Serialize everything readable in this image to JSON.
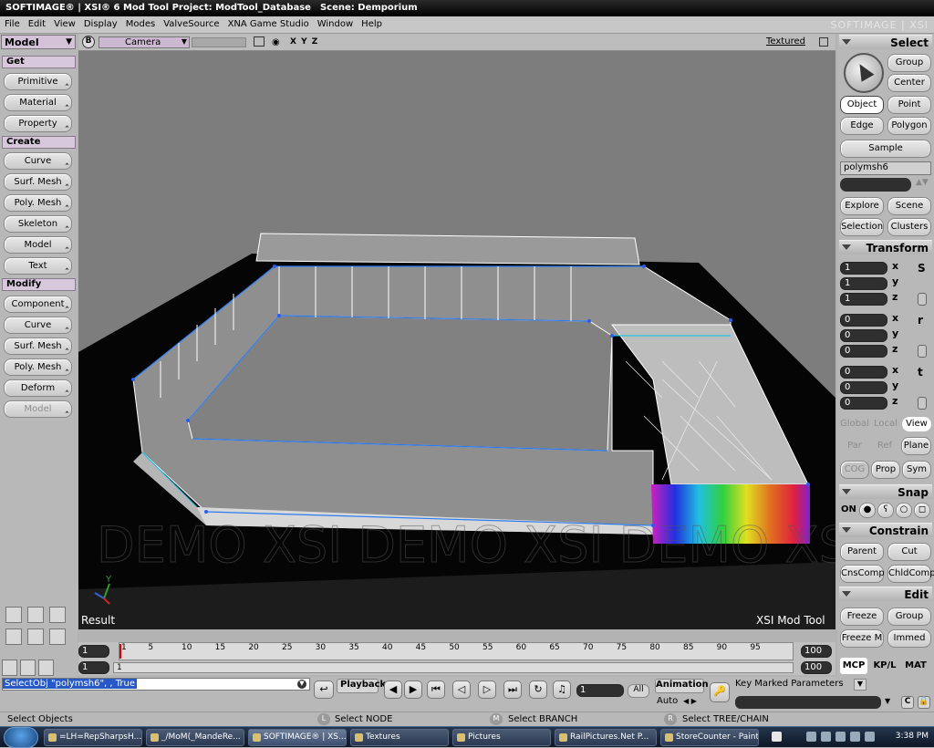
{
  "window": {
    "title": "SOFTIMAGE® | XSI® 6 Mod Tool Project: ModTool_Database",
    "scene": "Scene: Demporium",
    "brand": "SOFTIMAGE | XSI"
  },
  "menu": [
    "File",
    "Edit",
    "View",
    "Display",
    "Modes",
    "ValveSource",
    "XNA Game Studio",
    "Window",
    "Help"
  ],
  "left_panel": {
    "mode": "Model",
    "sections": {
      "get": "Get",
      "create": "Create",
      "modify": "Modify"
    },
    "get_buttons": [
      "Primitive",
      "Material",
      "Property"
    ],
    "create_buttons": [
      "Curve",
      "Surf. Mesh",
      "Poly. Mesh",
      "Skeleton",
      "Model",
      "Text"
    ],
    "modify_buttons": [
      "Component",
      "Curve",
      "Surf. Mesh",
      "Poly. Mesh",
      "Deform",
      "Model"
    ]
  },
  "viewport": {
    "b_button": "B",
    "camera": "Camera",
    "axes": "X Y Z",
    "display_mode": "Textured",
    "result_label": "Result",
    "product_label": "XSI Mod Tool",
    "watermark": "DEMO XSI DEMO XSI DEMO XSI DEMO XSI",
    "gizmo": {
      "y": "Y"
    }
  },
  "right_panel": {
    "select": {
      "header": "Select",
      "group": "Group",
      "center": "Center",
      "object": "Object",
      "point": "Point",
      "edge": "Edge",
      "polygon": "Polygon",
      "sample": "Sample",
      "name_field": "polymsh6",
      "explore": "Explore",
      "scene": "Scene",
      "selection": "Selection",
      "clusters": "Clusters"
    },
    "transform": {
      "header": "Transform",
      "scale": {
        "x": "1",
        "y": "1",
        "z": "1"
      },
      "rotate": {
        "x": "0",
        "y": "0",
        "z": "0"
      },
      "translate": {
        "x": "0",
        "y": "0",
        "z": "0"
      },
      "axis_x": "x",
      "axis_y": "y",
      "axis_z": "z",
      "side_s": "S",
      "side_r": "r",
      "side_t": "t",
      "global": "Global",
      "local": "Local",
      "view": "View",
      "par": "Par",
      "ref": "Ref",
      "plane": "Plane",
      "cog": "COG",
      "prop": "Prop",
      "sym": "Sym"
    },
    "snap": {
      "header": "Snap",
      "on": "ON"
    },
    "constrain": {
      "header": "Constrain",
      "parent": "Parent",
      "cut": "Cut",
      "cnscomp": "CnsComp",
      "chldcomp": "ChldComp"
    },
    "edit": {
      "header": "Edit",
      "freeze": "Freeze",
      "group": "Group",
      "freeze_m": "Freeze M",
      "immed": "Immed"
    },
    "tabs": [
      "MCP",
      "KP/L",
      "MAT"
    ]
  },
  "timeline": {
    "start": "1",
    "end": "100",
    "current": "1",
    "range_end": "100",
    "ticks": [
      "1",
      "5",
      "10",
      "15",
      "20",
      "25",
      "30",
      "35",
      "40",
      "45",
      "50",
      "55",
      "60",
      "65",
      "70",
      "75",
      "80",
      "85",
      "90",
      "95"
    ]
  },
  "command": {
    "text": "SelectObj \"polymsh6\", , True",
    "playback": "Playback",
    "frame": "1",
    "all": "All",
    "animation": "Animation",
    "auto": "Auto",
    "key_marked": "Key Marked Parameters"
  },
  "status": {
    "select_objects": "Select Objects",
    "l_key": "L",
    "m_key": "M",
    "r_key": "R",
    "select_node": "Select NODE",
    "select_branch": "Select BRANCH",
    "select_tree": "Select TREE/CHAIN"
  },
  "taskbar": {
    "tasks": [
      "=LH=RepSharpsH...",
      "_/MoM(_MandeRe...",
      "SOFTIMAGE® | XS...",
      "Textures",
      "Pictures",
      "RailPictures.Net P...",
      "StoreCounter - Paint"
    ],
    "clock": "3:38 PM"
  }
}
